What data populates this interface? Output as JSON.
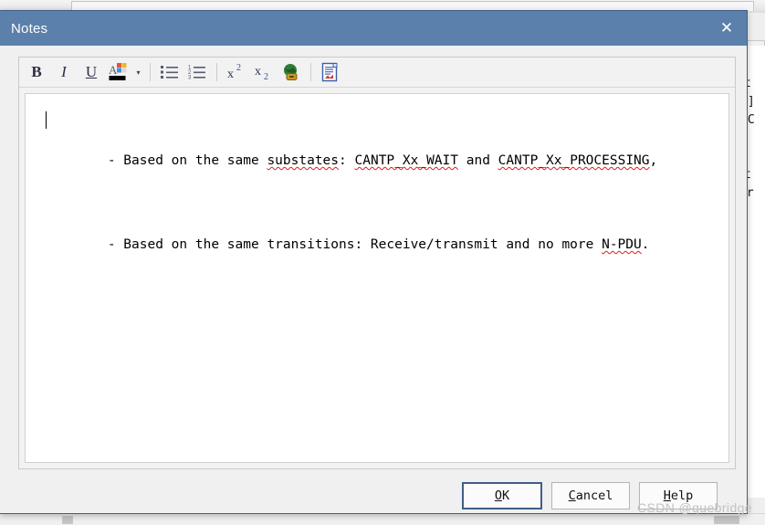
{
  "window": {
    "title": "Notes",
    "close_label": "✕",
    "titlebar_color": "#5b80ab",
    "border_color": "#3f5f86"
  },
  "toolbar": {
    "items": [
      {
        "name": "bold-icon",
        "glyph": "B",
        "style": "bold",
        "tooltip": "Bold"
      },
      {
        "name": "italic-icon",
        "glyph": "I",
        "style": "italic",
        "tooltip": "Italic"
      },
      {
        "name": "underline-icon",
        "glyph": "U",
        "style": "under",
        "tooltip": "Underline"
      },
      {
        "name": "font-color-icon",
        "glyph": "A",
        "style": "color",
        "tooltip": "Font Color"
      },
      {
        "name": "font-color-dropdown-icon",
        "glyph": "▾",
        "style": "arrow",
        "tooltip": "Font Color Options"
      },
      {
        "name": "bulleted-list-icon",
        "glyph": "",
        "style": "bullets",
        "tooltip": "Bulleted List"
      },
      {
        "name": "numbered-list-icon",
        "glyph": "",
        "style": "numbers",
        "tooltip": "Numbered List"
      },
      {
        "name": "superscript-icon",
        "glyph": "x",
        "style": "sup",
        "tooltip": "Superscript"
      },
      {
        "name": "subscript-icon",
        "glyph": "x",
        "style": "sub",
        "tooltip": "Subscript"
      },
      {
        "name": "hyperlink-icon",
        "glyph": "",
        "style": "globe",
        "tooltip": "Insert Hyperlink"
      },
      {
        "name": "insert-document-icon",
        "glyph": "",
        "style": "document",
        "tooltip": "Insert Document"
      }
    ],
    "font_color_swatch": "#000000"
  },
  "editor": {
    "lines": [
      {
        "segments": [
          {
            "text": "- Based on the same ",
            "misspelled": false
          },
          {
            "text": "substates",
            "misspelled": true
          },
          {
            "text": ": ",
            "misspelled": false
          },
          {
            "text": "CANTP_Xx_WAIT",
            "misspelled": true
          },
          {
            "text": " and ",
            "misspelled": false
          },
          {
            "text": "CANTP_Xx_PROCESSING",
            "misspelled": true
          },
          {
            "text": ",",
            "misspelled": false
          }
        ],
        "has_caret": true
      },
      {
        "segments": [
          {
            "text": "- Based on the same transitions: Receive/transmit and no more ",
            "misspelled": false
          },
          {
            "text": "N-PDU",
            "misspelled": true
          },
          {
            "text": ".",
            "misspelled": false
          }
        ],
        "has_caret": false
      }
    ],
    "spellcheck_color": "#e01b1b"
  },
  "buttons": {
    "ok": {
      "label": "OK",
      "mnemonic_index": 0,
      "is_default": true
    },
    "cancel": {
      "label": "Cancel",
      "mnemonic_index": 0,
      "is_default": false
    },
    "help": {
      "label": "Help",
      "mnemonic_index": 0,
      "is_default": false
    }
  },
  "background": {
    "doc_lines": [
      "t",
      "A]",
      "RC",
      "",
      "t",
      "ar"
    ],
    "watermark": "CSDN @quebridge"
  }
}
